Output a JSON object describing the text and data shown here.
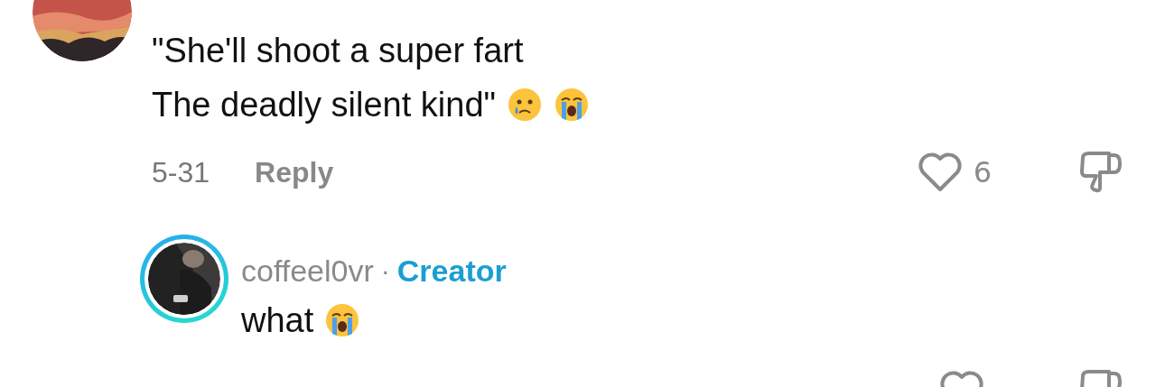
{
  "comments": [
    {
      "avatar": {
        "kind": "picture",
        "ring": false
      },
      "lines": [
        "\"She'll shoot a super fart",
        "The deadly silent kind\""
      ],
      "emojis": [
        {
          "kind": "sad-tear"
        },
        {
          "kind": "loudly-crying"
        }
      ],
      "date": "5-31",
      "reply_label": "Reply",
      "likes": "6",
      "liked": false,
      "replies": [
        {
          "avatar": {
            "kind": "picture",
            "ring": true
          },
          "username": "coffeel0vr",
          "separator": "·",
          "badge": "Creator",
          "lines": [
            "what"
          ],
          "emojis": [
            {
              "kind": "loudly-crying"
            }
          ],
          "liked": false
        }
      ]
    }
  ]
}
